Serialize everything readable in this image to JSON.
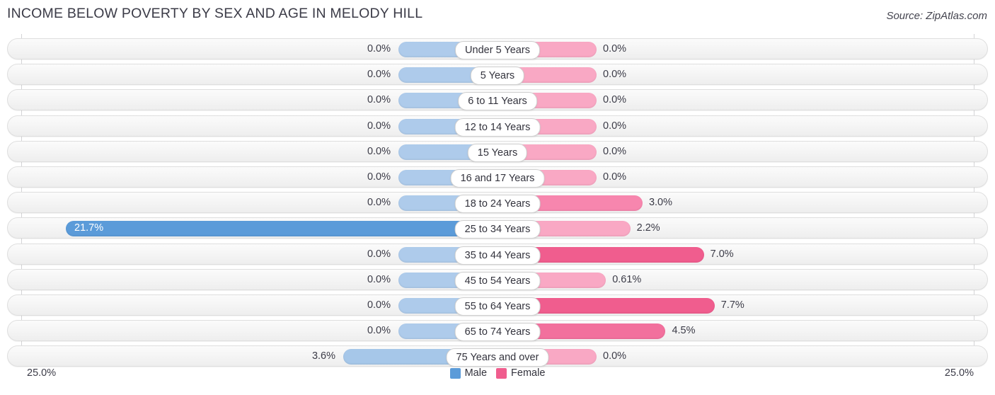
{
  "title": "INCOME BELOW POVERTY BY SEX AND AGE IN MELODY HILL",
  "source": "Source: ZipAtlas.com",
  "axis": {
    "left_label": "25.0%",
    "right_label": "25.0%",
    "max": 25.0
  },
  "legend": {
    "male": {
      "label": "Male",
      "color": "#5b9bd9"
    },
    "female": {
      "label": "Female",
      "color": "#f05d8e"
    }
  },
  "colors": {
    "male_pale": "#aecbeb",
    "male_strong": "#5b9bd9",
    "female_pale": "#f9a8c4",
    "female_mid": "#f786ae",
    "female_strong": "#f05d8e",
    "row_border": "#dedede",
    "text": "#3b3b47"
  },
  "chart_data": {
    "type": "bar",
    "subtype": "population-pyramid",
    "title": "INCOME BELOW POVERTY BY SEX AND AGE IN MELODY HILL",
    "xlabel": "",
    "ylabel": "",
    "xlim": [
      25.0,
      25.0
    ],
    "grid": false,
    "legend_position": "bottom-center",
    "categories": [
      "Under 5 Years",
      "5 Years",
      "6 to 11 Years",
      "12 to 14 Years",
      "15 Years",
      "16 and 17 Years",
      "18 to 24 Years",
      "25 to 34 Years",
      "35 to 44 Years",
      "45 to 54 Years",
      "55 to 64 Years",
      "65 to 74 Years",
      "75 Years and over"
    ],
    "series": [
      {
        "name": "Male",
        "values": [
          0.0,
          0.0,
          0.0,
          0.0,
          0.0,
          0.0,
          0.0,
          21.7,
          0.0,
          0.0,
          0.0,
          0.0,
          3.6
        ],
        "labels": [
          "0.0%",
          "0.0%",
          "0.0%",
          "0.0%",
          "0.0%",
          "0.0%",
          "0.0%",
          "21.7%",
          "0.0%",
          "0.0%",
          "0.0%",
          "0.0%",
          "3.6%"
        ]
      },
      {
        "name": "Female",
        "values": [
          0.0,
          0.0,
          0.0,
          0.0,
          0.0,
          0.0,
          3.0,
          2.2,
          7.0,
          0.61,
          7.7,
          4.5,
          0.0
        ],
        "labels": [
          "0.0%",
          "0.0%",
          "0.0%",
          "0.0%",
          "0.0%",
          "0.0%",
          "3.0%",
          "2.2%",
          "7.0%",
          "0.61%",
          "7.7%",
          "4.5%",
          "0.0%"
        ]
      }
    ]
  }
}
